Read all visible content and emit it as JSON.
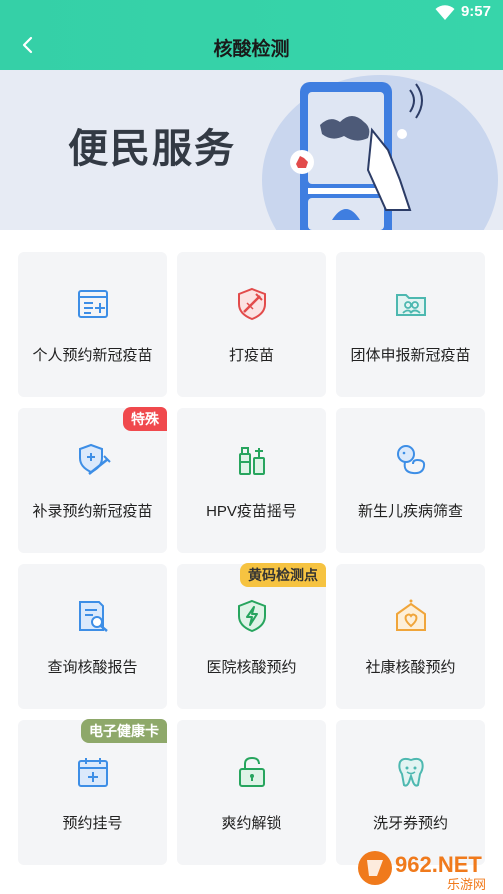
{
  "status_bar": {
    "time": "9:57"
  },
  "header": {
    "title": "核酸检测"
  },
  "banner": {
    "text": "便民服务"
  },
  "tiles": [
    {
      "label": "个人预约新冠疫苗",
      "icon": "form-icon",
      "color": "#3d8ee6",
      "tag": ""
    },
    {
      "label": "打疫苗",
      "icon": "syringe-shield-icon",
      "color": "#e24b4b",
      "tag": ""
    },
    {
      "label": "团体申报新冠疫苗",
      "icon": "group-folder-icon",
      "color": "#4db8b0",
      "tag": ""
    },
    {
      "label": "补录预约新冠疫苗",
      "icon": "vaccine-shield-icon",
      "color": "#3d8ee6",
      "tag": "特殊"
    },
    {
      "label": "HPV疫苗摇号",
      "icon": "vaccine-bottle-icon",
      "color": "#27a55e",
      "tag": ""
    },
    {
      "label": "新生儿疾病筛查",
      "icon": "baby-icon",
      "color": "#3d8ee6",
      "tag": ""
    },
    {
      "label": "查询核酸报告",
      "icon": "report-search-icon",
      "color": "#3d8ee6",
      "tag": ""
    },
    {
      "label": "医院核酸预约",
      "icon": "lightning-shield-icon",
      "color": "#27a55e",
      "tag": "黄码检测点"
    },
    {
      "label": "社康核酸预约",
      "icon": "community-house-icon",
      "color": "#f0a53a",
      "tag": ""
    },
    {
      "label": "预约挂号",
      "icon": "calendar-plus-icon",
      "color": "#3d8ee6",
      "tag": "电子健康卡"
    },
    {
      "label": "爽约解锁",
      "icon": "unlock-icon",
      "color": "#27a55e",
      "tag": ""
    },
    {
      "label": "洗牙券预约",
      "icon": "tooth-icon",
      "color": "#4db8b0",
      "tag": ""
    }
  ],
  "watermark": {
    "text": "962.NET",
    "subtext": "乐游网"
  }
}
